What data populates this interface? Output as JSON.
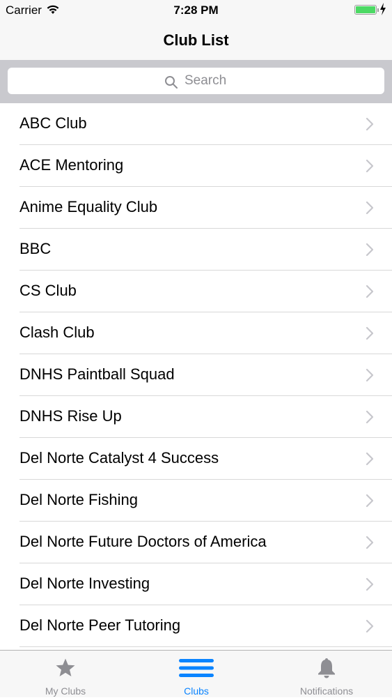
{
  "status_bar": {
    "carrier": "Carrier",
    "time": "7:28 PM"
  },
  "nav": {
    "title": "Club List"
  },
  "search": {
    "placeholder": "Search"
  },
  "clubs": [
    "ABC Club",
    "ACE Mentoring",
    "Anime Equality Club",
    "BBC",
    "CS Club",
    "Clash Club",
    "DNHS Paintball Squad",
    "DNHS Rise Up",
    "Del Norte Catalyst 4 Success",
    "Del Norte Fishing",
    "Del Norte Future Doctors of America",
    "Del Norte Investing",
    "Del Norte Peer Tutoring"
  ],
  "tabs": [
    {
      "label": "My Clubs",
      "icon": "star-icon",
      "active": false
    },
    {
      "label": "Clubs",
      "icon": "list-icon",
      "active": true
    },
    {
      "label": "Notifications",
      "icon": "bell-icon",
      "active": false
    }
  ],
  "colors": {
    "accent": "#0a84ff",
    "inactive": "#8e8e93",
    "battery": "#4cd964"
  }
}
